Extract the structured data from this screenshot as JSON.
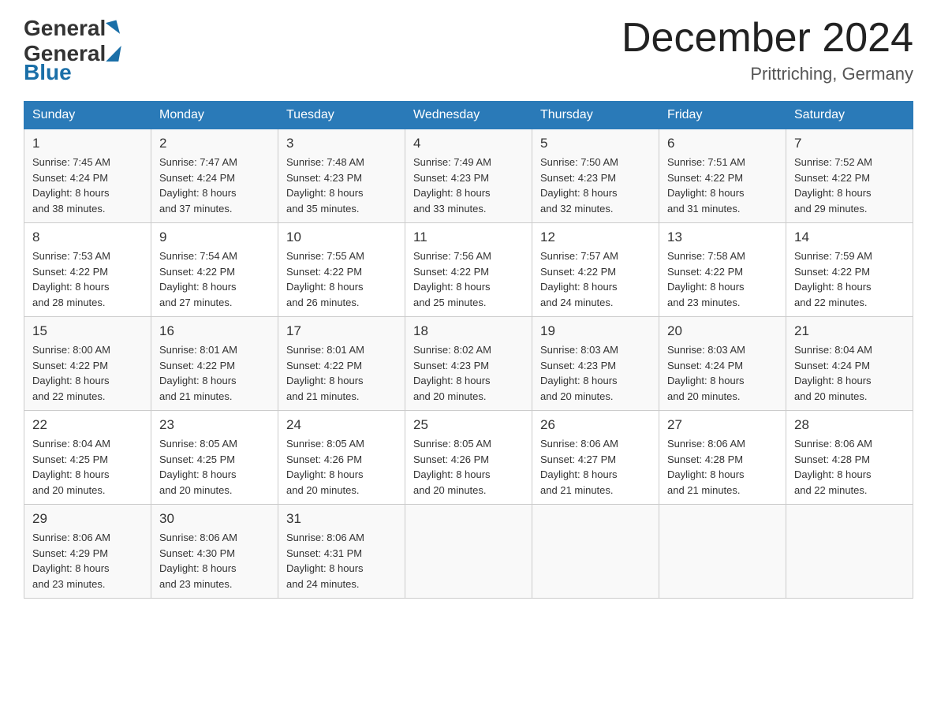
{
  "header": {
    "logo_general": "General",
    "logo_blue": "Blue",
    "title": "December 2024",
    "subtitle": "Prittriching, Germany"
  },
  "weekdays": [
    "Sunday",
    "Monday",
    "Tuesday",
    "Wednesday",
    "Thursday",
    "Friday",
    "Saturday"
  ],
  "weeks": [
    [
      {
        "day": "1",
        "sunrise": "7:45 AM",
        "sunset": "4:24 PM",
        "daylight": "8 hours and 38 minutes."
      },
      {
        "day": "2",
        "sunrise": "7:47 AM",
        "sunset": "4:24 PM",
        "daylight": "8 hours and 37 minutes."
      },
      {
        "day": "3",
        "sunrise": "7:48 AM",
        "sunset": "4:23 PM",
        "daylight": "8 hours and 35 minutes."
      },
      {
        "day": "4",
        "sunrise": "7:49 AM",
        "sunset": "4:23 PM",
        "daylight": "8 hours and 33 minutes."
      },
      {
        "day": "5",
        "sunrise": "7:50 AM",
        "sunset": "4:23 PM",
        "daylight": "8 hours and 32 minutes."
      },
      {
        "day": "6",
        "sunrise": "7:51 AM",
        "sunset": "4:22 PM",
        "daylight": "8 hours and 31 minutes."
      },
      {
        "day": "7",
        "sunrise": "7:52 AM",
        "sunset": "4:22 PM",
        "daylight": "8 hours and 29 minutes."
      }
    ],
    [
      {
        "day": "8",
        "sunrise": "7:53 AM",
        "sunset": "4:22 PM",
        "daylight": "8 hours and 28 minutes."
      },
      {
        "day": "9",
        "sunrise": "7:54 AM",
        "sunset": "4:22 PM",
        "daylight": "8 hours and 27 minutes."
      },
      {
        "day": "10",
        "sunrise": "7:55 AM",
        "sunset": "4:22 PM",
        "daylight": "8 hours and 26 minutes."
      },
      {
        "day": "11",
        "sunrise": "7:56 AM",
        "sunset": "4:22 PM",
        "daylight": "8 hours and 25 minutes."
      },
      {
        "day": "12",
        "sunrise": "7:57 AM",
        "sunset": "4:22 PM",
        "daylight": "8 hours and 24 minutes."
      },
      {
        "day": "13",
        "sunrise": "7:58 AM",
        "sunset": "4:22 PM",
        "daylight": "8 hours and 23 minutes."
      },
      {
        "day": "14",
        "sunrise": "7:59 AM",
        "sunset": "4:22 PM",
        "daylight": "8 hours and 22 minutes."
      }
    ],
    [
      {
        "day": "15",
        "sunrise": "8:00 AM",
        "sunset": "4:22 PM",
        "daylight": "8 hours and 22 minutes."
      },
      {
        "day": "16",
        "sunrise": "8:01 AM",
        "sunset": "4:22 PM",
        "daylight": "8 hours and 21 minutes."
      },
      {
        "day": "17",
        "sunrise": "8:01 AM",
        "sunset": "4:22 PM",
        "daylight": "8 hours and 21 minutes."
      },
      {
        "day": "18",
        "sunrise": "8:02 AM",
        "sunset": "4:23 PM",
        "daylight": "8 hours and 20 minutes."
      },
      {
        "day": "19",
        "sunrise": "8:03 AM",
        "sunset": "4:23 PM",
        "daylight": "8 hours and 20 minutes."
      },
      {
        "day": "20",
        "sunrise": "8:03 AM",
        "sunset": "4:24 PM",
        "daylight": "8 hours and 20 minutes."
      },
      {
        "day": "21",
        "sunrise": "8:04 AM",
        "sunset": "4:24 PM",
        "daylight": "8 hours and 20 minutes."
      }
    ],
    [
      {
        "day": "22",
        "sunrise": "8:04 AM",
        "sunset": "4:25 PM",
        "daylight": "8 hours and 20 minutes."
      },
      {
        "day": "23",
        "sunrise": "8:05 AM",
        "sunset": "4:25 PM",
        "daylight": "8 hours and 20 minutes."
      },
      {
        "day": "24",
        "sunrise": "8:05 AM",
        "sunset": "4:26 PM",
        "daylight": "8 hours and 20 minutes."
      },
      {
        "day": "25",
        "sunrise": "8:05 AM",
        "sunset": "4:26 PM",
        "daylight": "8 hours and 20 minutes."
      },
      {
        "day": "26",
        "sunrise": "8:06 AM",
        "sunset": "4:27 PM",
        "daylight": "8 hours and 21 minutes."
      },
      {
        "day": "27",
        "sunrise": "8:06 AM",
        "sunset": "4:28 PM",
        "daylight": "8 hours and 21 minutes."
      },
      {
        "day": "28",
        "sunrise": "8:06 AM",
        "sunset": "4:28 PM",
        "daylight": "8 hours and 22 minutes."
      }
    ],
    [
      {
        "day": "29",
        "sunrise": "8:06 AM",
        "sunset": "4:29 PM",
        "daylight": "8 hours and 23 minutes."
      },
      {
        "day": "30",
        "sunrise": "8:06 AM",
        "sunset": "4:30 PM",
        "daylight": "8 hours and 23 minutes."
      },
      {
        "day": "31",
        "sunrise": "8:06 AM",
        "sunset": "4:31 PM",
        "daylight": "8 hours and 24 minutes."
      },
      null,
      null,
      null,
      null
    ]
  ],
  "labels": {
    "sunrise": "Sunrise:",
    "sunset": "Sunset:",
    "daylight": "Daylight:"
  }
}
